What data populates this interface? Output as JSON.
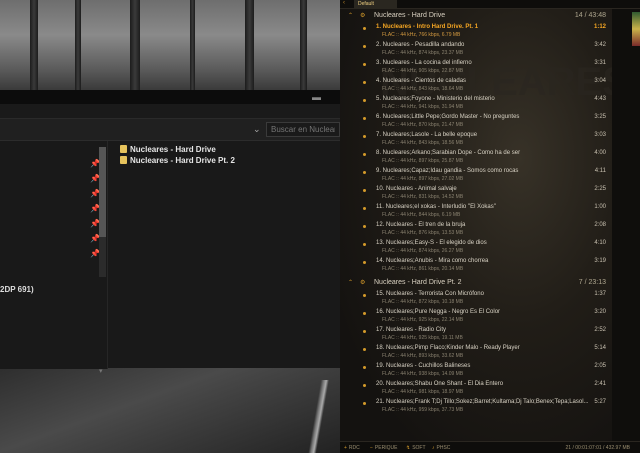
{
  "explorer": {
    "search_placeholder": "Buscar en Nucleares",
    "disk_label": "2DP 691)",
    "files": [
      {
        "name": "Nucleares - Hard Drive"
      },
      {
        "name": "Nucleares - Hard Drive Pt. 2"
      }
    ]
  },
  "foobar": {
    "tab_label": "Default",
    "groups": [
      {
        "title": "Nucleares - Hard Drive",
        "info": "14 / 43:48",
        "tracks": [
          {
            "title": "1. Nucleares - Intro Hard Drive. Pt. 1",
            "sub": "FLAC :: 44 kHz, 766 kbps, 6.79 MB",
            "dur": "1:12",
            "playing": true
          },
          {
            "title": "2. Nucleares - Pesadilla andando",
            "sub": "FLAC :: 44 kHz, 874 kbps, 23.37 MB",
            "dur": "3:42"
          },
          {
            "title": "3. Nucleares - La cocina del infierno",
            "sub": "FLAC :: 44 kHz, 905 kbps, 22.87 MB",
            "dur": "3:31"
          },
          {
            "title": "4. Nucleares - Cientos de caladas",
            "sub": "FLAC :: 44 kHz, 843 kbps, 18.64 MB",
            "dur": "3:04"
          },
          {
            "title": "5. Nucleares;Foyone - Ministerio del misterio",
            "sub": "FLAC :: 44 kHz, 941 kbps, 31.94 MB",
            "dur": "4:43"
          },
          {
            "title": "6. Nucleares;Little Pepe;Gordo Master - No preguntes",
            "sub": "FLAC :: 44 kHz, 870 kbps, 21.47 MB",
            "dur": "3:25"
          },
          {
            "title": "7. Nucleares;Lasole - La belle epoque",
            "sub": "FLAC :: 44 kHz, 843 kbps, 18.56 MB",
            "dur": "3:03"
          },
          {
            "title": "8. Nucleares;Arkano;Sarabian Dope - Como ha de ser",
            "sub": "FLAC :: 44 kHz, 897 kbps, 25.87 MB",
            "dur": "4:00"
          },
          {
            "title": "9. Nucleares;Capaz;Idau gandia - Somos como rocas",
            "sub": "FLAC :: 44 kHz, 897 kbps, 27.02 MB",
            "dur": "4:11"
          },
          {
            "title": "10. Nucleares - Animal salvaje",
            "sub": "FLAC :: 44 kHz, 831 kbps, 14.52 MB",
            "dur": "2:25"
          },
          {
            "title": "11. Nucleares;el xokas - Interludio \"El Xokas\"",
            "sub": "FLAC :: 44 kHz, 844 kbps, 6.19 MB",
            "dur": "1:00"
          },
          {
            "title": "12. Nucleares - El tren de la bruja",
            "sub": "FLAC :: 44 kHz, 876 kbps, 13.53 MB",
            "dur": "2:08"
          },
          {
            "title": "13. Nucleares;Easy-S - El elegido de dios",
            "sub": "FLAC :: 44 kHz, 874 kbps, 26.27 MB",
            "dur": "4:10"
          },
          {
            "title": "14. Nucleares;Anubis - Mira como chorrea",
            "sub": "FLAC :: 44 kHz, 861 kbps, 20.14 MB",
            "dur": "3:19"
          }
        ]
      },
      {
        "title": "Nucleares - Hard Drive Pt. 2",
        "info": "7 / 23:13",
        "tracks": [
          {
            "title": "15. Nucleares - Terrorista Con Micrófono",
            "sub": "FLAC :: 44 kHz, 872 kbps, 10.18 MB",
            "dur": "1:37"
          },
          {
            "title": "16. Nucleares;Pure Negga - Negro Es El Color",
            "sub": "FLAC :: 44 kHz, 925 kbps, 22.14 MB",
            "dur": "3:20"
          },
          {
            "title": "17. Nucleares - Radio City",
            "sub": "FLAC :: 44 kHz, 925 kbps, 19.11 MB",
            "dur": "2:52"
          },
          {
            "title": "18. Nucleares;Pimp Flaco;Kinder Malo - Ready Player",
            "sub": "FLAC :: 44 kHz, 893 kbps, 33.62 MB",
            "dur": "5:14"
          },
          {
            "title": "19. Nucleares - Cuchillos Balineses",
            "sub": "FLAC :: 44 kHz, 938 kbps, 14.09 MB",
            "dur": "2:05"
          },
          {
            "title": "20. Nucleares;Shabu One Shant - El Dia Entero",
            "sub": "FLAC :: 44 kHz, 981 kbps, 18.97 MB",
            "dur": "2:41"
          },
          {
            "title": "21. Nucleares;Frank T;Dj Tillo;Sokez;Barret;Kultama;Dj Talo;Benex;Tepa;Lasol...",
            "sub": "FLAC :: 44 kHz, 959 kbps, 37.73 MB",
            "dur": "5:27"
          }
        ]
      }
    ],
    "status": {
      "btn1": "RDC",
      "btn2": "PERIQUE",
      "btn3": "SOFT",
      "btn4": "PHSC",
      "info": "21 / 00:01:07:01 / 432.97 MB"
    }
  }
}
